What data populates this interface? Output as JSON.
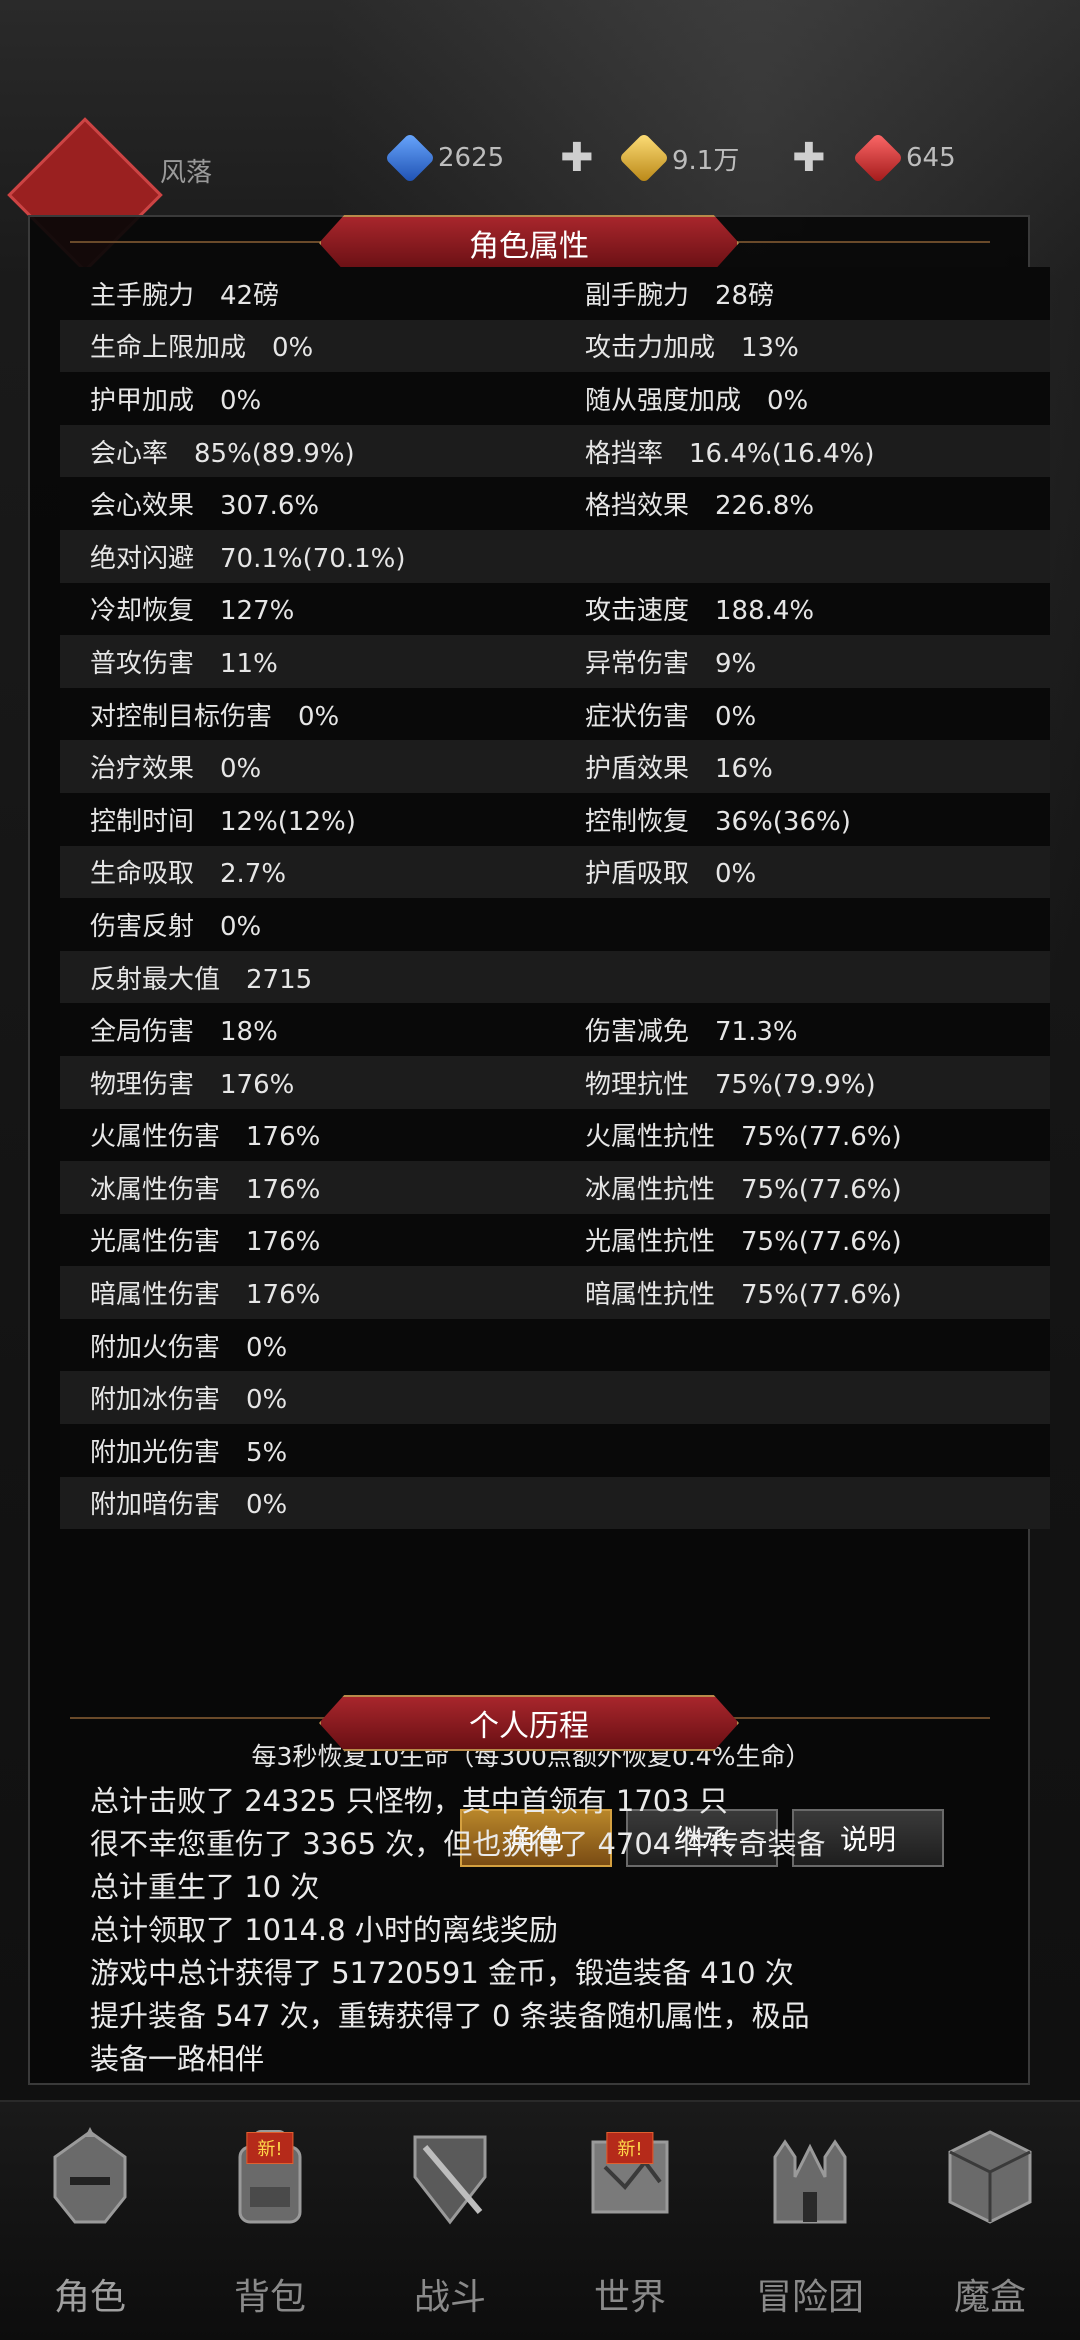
{
  "header": {
    "player_name": "风落",
    "resources": {
      "blue_gem": "2625",
      "gold_gem": "9.1万",
      "red_gem": "645"
    }
  },
  "attributes": {
    "title": "角色属性",
    "rows": [
      {
        "left": "主手腕力　42磅",
        "right": "副手腕力　28磅"
      },
      {
        "left": "生命上限加成　0%",
        "right": "攻击力加成　13%"
      },
      {
        "left": "护甲加成　0%",
        "right": "随从强度加成　0%"
      },
      {
        "left": "会心率　85%(89.9%)",
        "right": "格挡率　16.4%(16.4%)"
      },
      {
        "left": "会心效果　307.6%",
        "right": "格挡效果　226.8%"
      },
      {
        "left": "绝对闪避　70.1%(70.1%)",
        "right": ""
      },
      {
        "left": "冷却恢复　127%",
        "right": "攻击速度　188.4%"
      },
      {
        "left": "普攻伤害　11%",
        "right": "异常伤害　9%"
      },
      {
        "left": "对控制目标伤害　0%",
        "right": "症状伤害　0%"
      },
      {
        "left": "治疗效果　0%",
        "right": "护盾效果　16%"
      },
      {
        "left": "控制时间　12%(12%)",
        "right": "控制恢复　36%(36%)"
      },
      {
        "left": "生命吸取　2.7%",
        "right": "护盾吸取　0%"
      },
      {
        "left": "伤害反射　0%",
        "right": ""
      },
      {
        "left": "反射最大值　2715",
        "right": ""
      },
      {
        "left": "全局伤害　18%",
        "right": "伤害减免　71.3%"
      },
      {
        "left": "物理伤害　176%",
        "right": "物理抗性　75%(79.9%)"
      },
      {
        "left": "火属性伤害　176%",
        "right": "火属性抗性　75%(77.6%)"
      },
      {
        "left": "冰属性伤害　176%",
        "right": "冰属性抗性　75%(77.6%)"
      },
      {
        "left": "光属性伤害　176%",
        "right": "光属性抗性　75%(77.6%)"
      },
      {
        "left": "暗属性伤害　176%",
        "right": "暗属性抗性　75%(77.6%)"
      },
      {
        "left": "附加火伤害　0%",
        "right": ""
      },
      {
        "left": "附加冰伤害　0%",
        "right": ""
      },
      {
        "left": "附加光伤害　5%",
        "right": ""
      },
      {
        "left": "附加暗伤害　0%",
        "right": ""
      }
    ],
    "footnote": "每3秒恢复10生命（每300点额外恢复0.4%生命）"
  },
  "buttons": {
    "character": "角色",
    "inherit": "继承",
    "explain": "说明"
  },
  "history": {
    "title": "个人历程",
    "lines": [
      "总计击败了 24325 只怪物，其中首领有 1703 只",
      "很不幸您重伤了 3365 次，但也获得了 4704 件传奇装备",
      "总计重生了 10 次",
      "总计领取了 1014.8 小时的离线奖励",
      "游戏中总计获得了 51720591 金币，锻造装备 410 次",
      "提升装备 547 次，重铸获得了 0 条装备随机属性，极品",
      "装备一路相伴"
    ]
  },
  "nav": {
    "items": [
      {
        "label": "角色",
        "icon": "helmet-icon",
        "badge": ""
      },
      {
        "label": "背包",
        "icon": "backpack-icon",
        "badge": "新!"
      },
      {
        "label": "战斗",
        "icon": "swords-icon",
        "badge": ""
      },
      {
        "label": "世界",
        "icon": "map-scroll-icon",
        "badge": "新!"
      },
      {
        "label": "冒险团",
        "icon": "castle-icon",
        "badge": ""
      },
      {
        "label": "魔盒",
        "icon": "cube-icon",
        "badge": ""
      }
    ]
  }
}
